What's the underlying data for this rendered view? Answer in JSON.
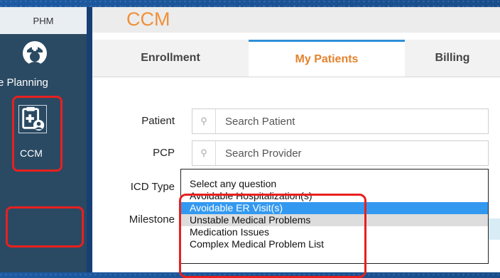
{
  "sidebar": {
    "tab_label": "PHM",
    "items": [
      {
        "label": "re Planning",
        "icon": "nurse-icon"
      },
      {
        "label": "CCM",
        "icon": "clipboard-patient-icon"
      }
    ]
  },
  "main": {
    "title": "CCM",
    "tabs": [
      {
        "label": "Enrollment"
      },
      {
        "label": "My Patients",
        "active": true
      },
      {
        "label": "Billing"
      }
    ],
    "form": {
      "patient": {
        "label": "Patient",
        "placeholder": "Search Patient"
      },
      "pcp": {
        "label": "PCP",
        "placeholder": "Search Provider"
      },
      "icd_type": {
        "label": "ICD Type"
      },
      "milestone": {
        "label": "Milestone"
      }
    },
    "dropdown": {
      "options": [
        "Select any question",
        "Avoidable Hospitalization(s)",
        "Avoidable ER Visit(s)",
        "Unstable Medical Problems",
        "Medication Issues",
        "Complex Medical Problem List"
      ],
      "selected": "Avoidable ER Visit(s)"
    }
  },
  "colors": {
    "accent_orange": "#f0903a",
    "highlight_red": "#e8201f",
    "selection_blue": "#3399f0",
    "sidebar": "#2a4a63"
  }
}
